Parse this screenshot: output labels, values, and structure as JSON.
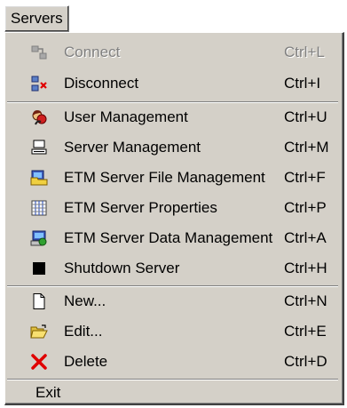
{
  "menubar": {
    "title": "Servers"
  },
  "menu": {
    "items": [
      {
        "label": "Connect",
        "shortcut": "Ctrl+L",
        "icon": "connect-icon",
        "enabled": false
      },
      {
        "label": "Disconnect",
        "shortcut": "Ctrl+I",
        "icon": "disconnect-icon",
        "enabled": true
      },
      {
        "label": "User Management",
        "shortcut": "Ctrl+U",
        "icon": "user-management-icon",
        "enabled": true
      },
      {
        "label": "Server Management",
        "shortcut": "Ctrl+M",
        "icon": "server-management-icon",
        "enabled": true
      },
      {
        "label": "ETM Server File Management",
        "shortcut": "Ctrl+F",
        "icon": "file-management-icon",
        "enabled": true
      },
      {
        "label": "ETM Server Properties",
        "shortcut": "Ctrl+P",
        "icon": "properties-icon",
        "enabled": true
      },
      {
        "label": "ETM Server Data Management",
        "shortcut": "Ctrl+A",
        "icon": "data-management-icon",
        "enabled": true
      },
      {
        "label": "Shutdown Server",
        "shortcut": "Ctrl+H",
        "icon": "shutdown-icon",
        "enabled": true
      },
      {
        "label": "New...",
        "shortcut": "Ctrl+N",
        "icon": "new-document-icon",
        "enabled": true
      },
      {
        "label": "Edit...",
        "shortcut": "Ctrl+E",
        "icon": "open-folder-icon",
        "enabled": true
      },
      {
        "label": "Delete",
        "shortcut": "Ctrl+D",
        "icon": "delete-icon",
        "enabled": true
      },
      {
        "label": "Exit",
        "shortcut": "",
        "icon": "",
        "enabled": true
      }
    ]
  }
}
